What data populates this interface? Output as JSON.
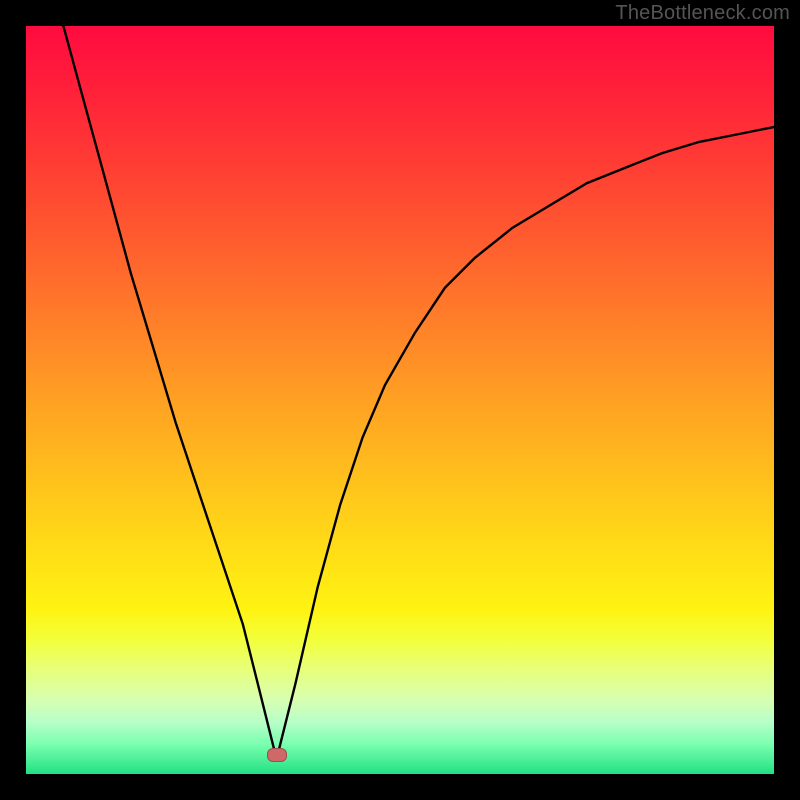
{
  "watermark": "TheBottleneck.com",
  "marker": {
    "x_pct": 33.5,
    "y_pct": 97.5
  },
  "chart_data": {
    "type": "line",
    "title": "",
    "xlabel": "",
    "ylabel": "",
    "xlim": [
      0,
      100
    ],
    "ylim": [
      0,
      100
    ],
    "grid": false,
    "legend": false,
    "annotations": [],
    "series": [
      {
        "name": "bottleneck-curve",
        "x": [
          5,
          8,
          11,
          14,
          17,
          20,
          23,
          26,
          29,
          31,
          33,
          33.5,
          34,
          36,
          39,
          42,
          45,
          48,
          52,
          56,
          60,
          65,
          70,
          75,
          80,
          85,
          90,
          95,
          100
        ],
        "y": [
          100,
          89,
          78,
          67,
          57,
          47,
          38,
          29,
          20,
          12,
          4,
          2,
          4,
          12,
          25,
          36,
          45,
          52,
          59,
          65,
          69,
          73,
          76,
          79,
          81,
          83,
          84.5,
          85.5,
          86.5
        ]
      }
    ],
    "background_gradient": {
      "stops": [
        {
          "pos": 0,
          "color": "#ff0b3f"
        },
        {
          "pos": 8,
          "color": "#ff1f3a"
        },
        {
          "pos": 18,
          "color": "#ff3b34"
        },
        {
          "pos": 28,
          "color": "#ff5a2f"
        },
        {
          "pos": 38,
          "color": "#ff7a2a"
        },
        {
          "pos": 48,
          "color": "#ff9a24"
        },
        {
          "pos": 58,
          "color": "#ffb91e"
        },
        {
          "pos": 68,
          "color": "#ffd718"
        },
        {
          "pos": 78,
          "color": "#fff312"
        },
        {
          "pos": 82,
          "color": "#f3ff3a"
        },
        {
          "pos": 86,
          "color": "#e8ff7a"
        },
        {
          "pos": 90,
          "color": "#d8ffb0"
        },
        {
          "pos": 93,
          "color": "#b8ffc8"
        },
        {
          "pos": 96,
          "color": "#7affb0"
        },
        {
          "pos": 100,
          "color": "#22e083"
        }
      ]
    }
  }
}
